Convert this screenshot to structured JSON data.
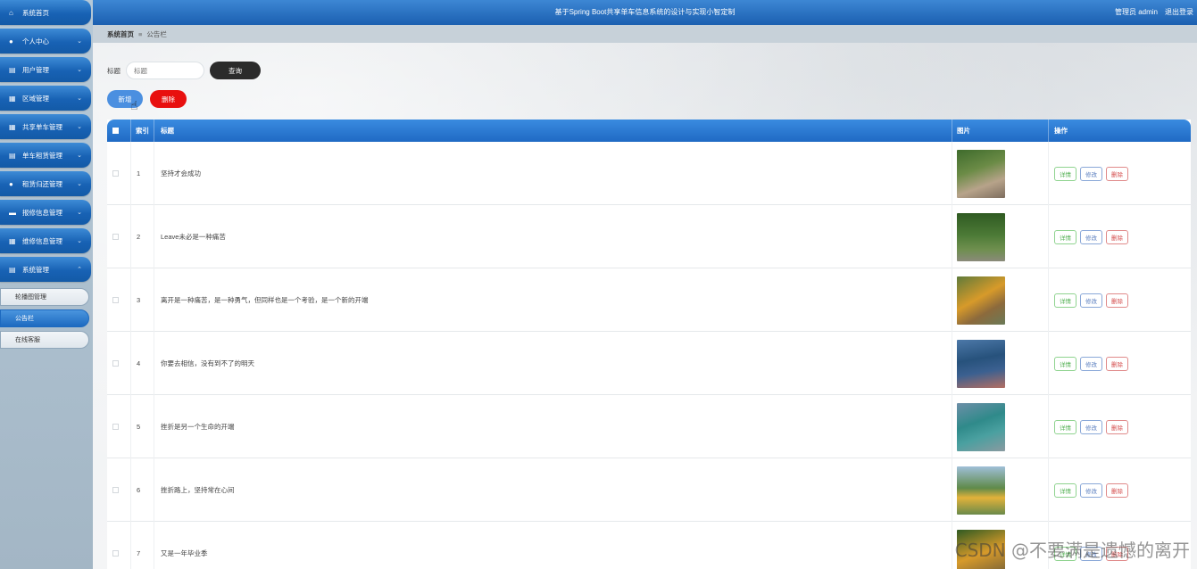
{
  "header": {
    "title": "基于Spring Boot共享单车信息系统的设计与实现小智定制",
    "user": "管理员 admin",
    "logout": "退出登录"
  },
  "sidebar": {
    "items": [
      {
        "label": "系统首页",
        "icon": "home-icon"
      },
      {
        "label": "个人中心",
        "icon": "user-icon"
      },
      {
        "label": "用户管理",
        "icon": "document-icon"
      },
      {
        "label": "区域管理",
        "icon": "grid-icon"
      },
      {
        "label": "共享单车管理",
        "icon": "grid-icon"
      },
      {
        "label": "单车租赁管理",
        "icon": "document-icon"
      },
      {
        "label": "租赁归还管理",
        "icon": "user-icon"
      },
      {
        "label": "报修信息管理",
        "icon": "monitor-icon"
      },
      {
        "label": "维修信息管理",
        "icon": "grid-icon"
      },
      {
        "label": "系统管理",
        "icon": "document-icon"
      }
    ],
    "subitems": [
      {
        "label": "轮播图管理"
      },
      {
        "label": "公告栏"
      },
      {
        "label": "在线客服"
      }
    ]
  },
  "breadcrumb": {
    "home": "系统首页",
    "separator": "≡",
    "current": "公告栏"
  },
  "search": {
    "label": "标题",
    "placeholder": "标题",
    "button": "查询"
  },
  "actions": {
    "add": "新增",
    "delete": "删除"
  },
  "table": {
    "columns": {
      "index": "索引",
      "title": "标题",
      "image": "图片",
      "action": "操作"
    },
    "row_actions": {
      "detail": "详情",
      "edit": "修改",
      "delete": "删除"
    },
    "rows": [
      {
        "index": "1",
        "title": "坚持才会成功"
      },
      {
        "index": "2",
        "title": "Leave未必是一种痛苦"
      },
      {
        "index": "3",
        "title": "离开是一种痛苦，是一种勇气，但同样也是一个考验，是一个新的开端"
      },
      {
        "index": "4",
        "title": "你要去相信，没有到不了的明天"
      },
      {
        "index": "5",
        "title": "挫折是另一个生命的开端"
      },
      {
        "index": "6",
        "title": "挫折路上，坚持常在心间"
      },
      {
        "index": "7",
        "title": "又是一年毕业季"
      }
    ]
  },
  "watermark": "CSDN @不要满是遗憾的离开",
  "colors": {
    "header_blue": "#1b5fb0",
    "add_blue": "#4b8fe0",
    "delete_red": "#e8100f"
  }
}
